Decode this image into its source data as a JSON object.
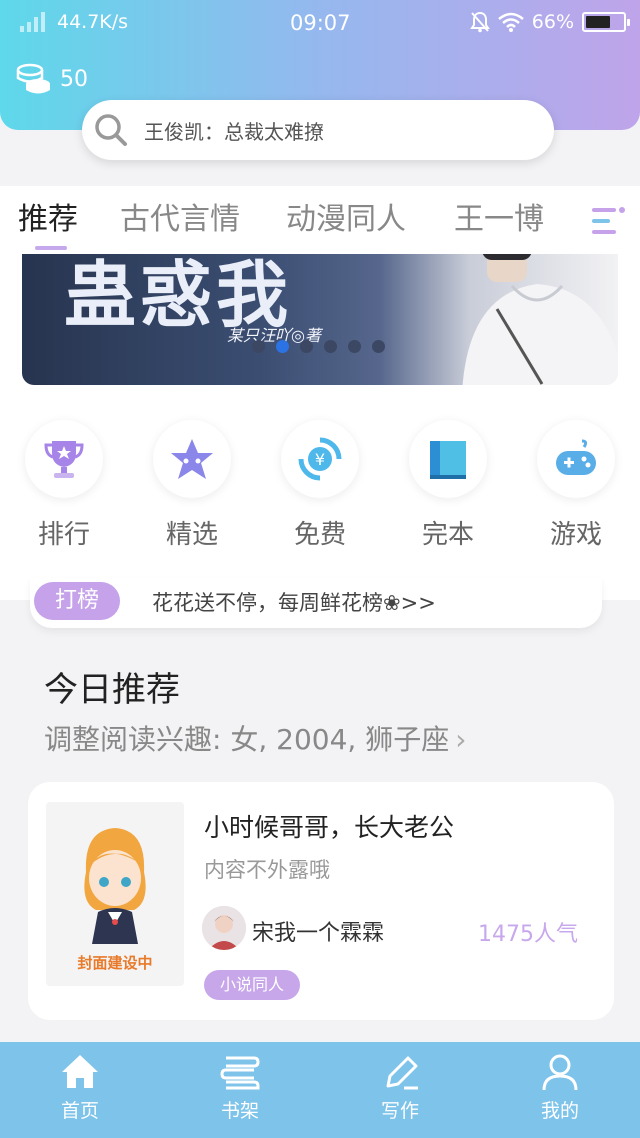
{
  "status_bar": {
    "speed": "44.7K/s",
    "time": "09:07",
    "battery": "66%",
    "battery_level": 0.66
  },
  "header": {
    "coins": "50",
    "search_placeholder": "王俊凯：总裁太难撩"
  },
  "tabs": [
    "推荐",
    "古代言情",
    "动漫同人",
    "王一博"
  ],
  "banner": {
    "title": "蛊惑我",
    "author_line": "某只汪吖◎著",
    "page_count": 6,
    "active_page": 1
  },
  "quick_entries": [
    {
      "label": "排行",
      "icon": "trophy-icon",
      "color": "#a684e8"
    },
    {
      "label": "精选",
      "icon": "star-icon",
      "color": "#8a86ea"
    },
    {
      "label": "免费",
      "icon": "yuan-icon",
      "color": "#4fb8ea"
    },
    {
      "label": "完本",
      "icon": "book-icon",
      "color": "#4fbfe6"
    },
    {
      "label": "游戏",
      "icon": "gamepad-icon",
      "color": "#5aaee8"
    }
  ],
  "notice": {
    "badge": "打榜",
    "text": "花花送不停，每周鲜花榜❀>>"
  },
  "today": {
    "title": "今日推荐",
    "subtitle": "调整阅读兴趣: 女, 2004, 狮子座"
  },
  "book": {
    "cover_text": "封面建设中",
    "title": "小时候哥哥，长大老公",
    "description": "内容不外露哦",
    "author": "宋我一个霖霖",
    "popularity": "1475人气",
    "tag": "小说同人"
  },
  "bottom_nav": [
    "首页",
    "书架",
    "写作",
    "我的"
  ],
  "colors": {
    "accent": "#c5a2ea",
    "nav_bg": "#7dc3ea",
    "header_start": "#5ed8ea",
    "header_end": "#bfa4ea"
  }
}
